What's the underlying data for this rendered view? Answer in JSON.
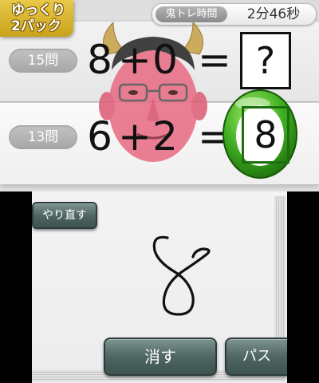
{
  "mode": {
    "line1": "ゆっくり",
    "line2": "2パック"
  },
  "timer": {
    "label": "鬼トレ時間",
    "value": "2分46秒"
  },
  "questions": [
    {
      "label": "15問",
      "a": "8",
      "op": "+",
      "b": "0",
      "eq": "=",
      "answer": "?"
    },
    {
      "label": "13問",
      "a": "6",
      "op": "+",
      "b": "2",
      "eq": "=",
      "answer": "8"
    }
  ],
  "controls": {
    "redo_label": "やり直す",
    "erase_label": "消す",
    "pass_label": "パス"
  },
  "icons": {
    "demon": "demon-face-icon",
    "correct": "correct-ring-icon",
    "ink": "handwritten-eight"
  },
  "colors": {
    "accent_gold": "#d4af2a",
    "correct_green": "#2f9a1a",
    "button_teal": "#4f6663"
  }
}
